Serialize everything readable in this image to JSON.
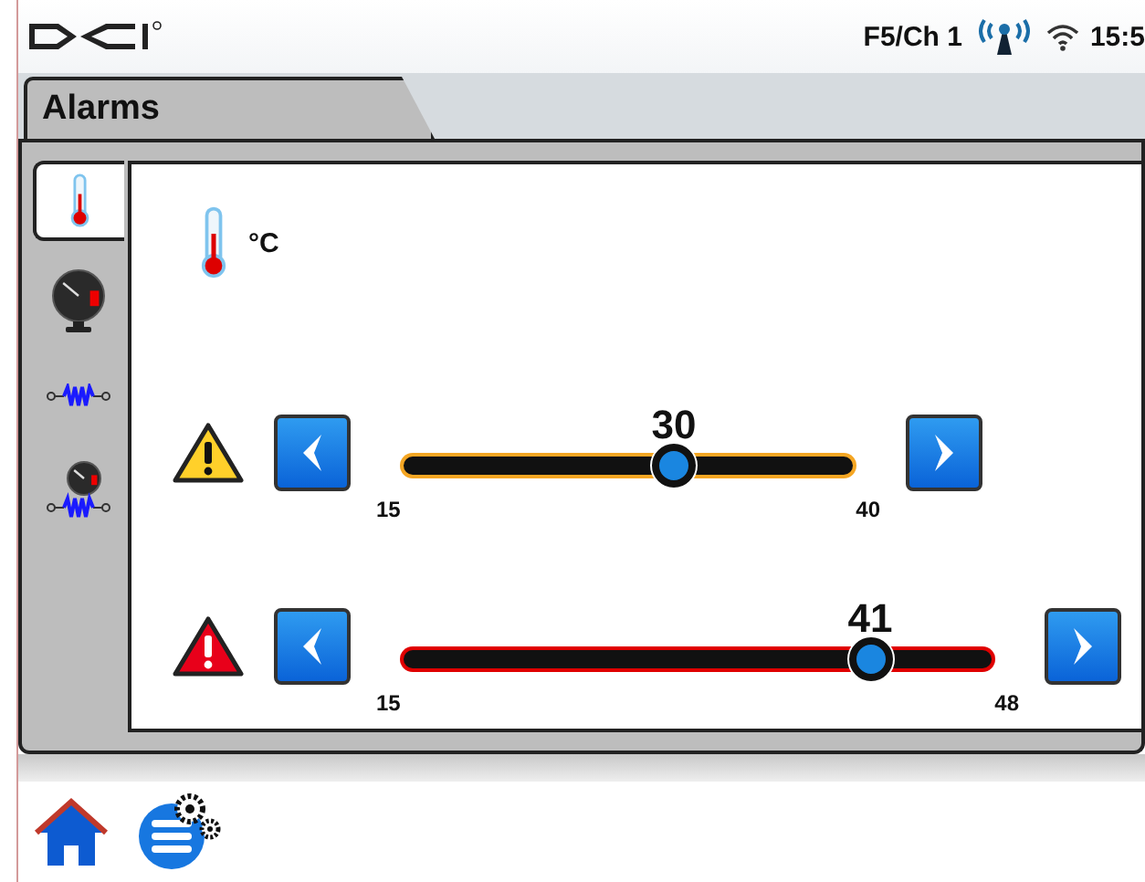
{
  "status_bar": {
    "channel": "F5/Ch 1",
    "time": "15:5"
  },
  "tab": {
    "label": "Alarms",
    "selected": true
  },
  "categories": [
    {
      "kind": "temperature",
      "selected": true
    },
    {
      "kind": "gauge",
      "selected": false
    },
    {
      "kind": "spring",
      "selected": false
    },
    {
      "kind": "gauge-spring",
      "selected": false
    }
  ],
  "unit": "°C",
  "thresholds": [
    {
      "kind": "warning",
      "color": "#f5a623",
      "value": "30",
      "min": "15",
      "max": "40",
      "level": 0.6
    },
    {
      "kind": "alarm",
      "color": "#e00000",
      "value": "41",
      "min": "15",
      "max": "48",
      "level": 0.79
    }
  ]
}
